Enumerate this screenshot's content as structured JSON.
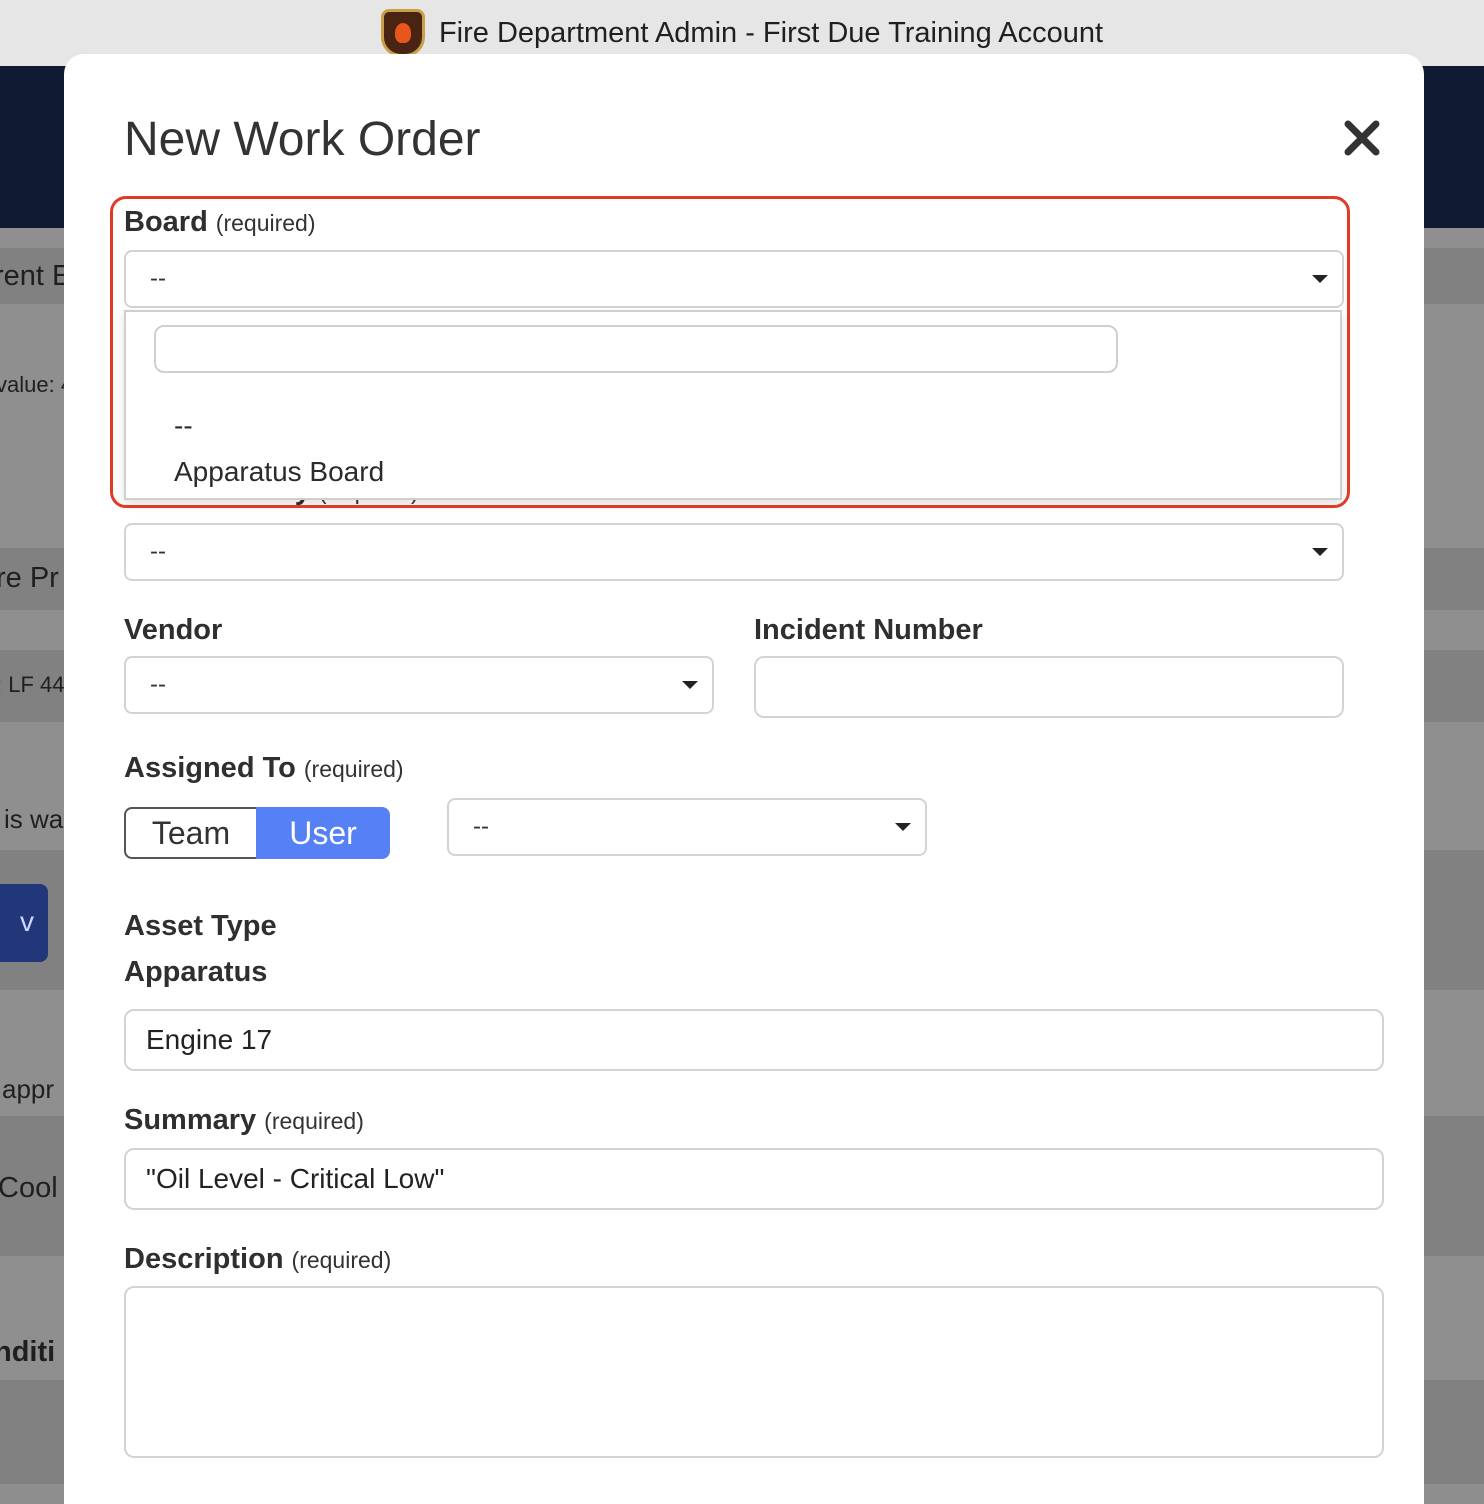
{
  "window": {
    "title": "Fire Department Admin - First Due Training Account",
    "logo_icon": "fire-department-badge-icon"
  },
  "background": {
    "texts": [
      "rent E",
      "value: 4",
      "re Pr",
      ": LF 44",
      "is wa",
      "appr",
      "Cool",
      "nditi"
    ],
    "button_text": "v"
  },
  "modal": {
    "title": "New Work Order",
    "close_icon": "close-icon",
    "required_text": "(required)",
    "board": {
      "label": "Board",
      "value": "--",
      "dropdown": {
        "search_value": "",
        "options": [
          "--",
          "Apparatus Board"
        ]
      },
      "highlight_color": "#e03a28"
    },
    "submitted_by": {
      "label": "Submitted By",
      "value": "--"
    },
    "vendor": {
      "label": "Vendor",
      "value": "--"
    },
    "incident_number": {
      "label": "Incident Number",
      "value": ""
    },
    "assigned_to": {
      "label": "Assigned To",
      "toggle": [
        "Team",
        "User"
      ],
      "selected": "User",
      "value": "--"
    },
    "asset_type": {
      "label": "Asset Type",
      "value": "Apparatus"
    },
    "asset": {
      "value": "Engine 17"
    },
    "summary": {
      "label": "Summary",
      "value": "\"Oil Level - Critical Low\""
    },
    "description": {
      "label": "Description",
      "value": ""
    },
    "accent_color": "#5680f5"
  }
}
